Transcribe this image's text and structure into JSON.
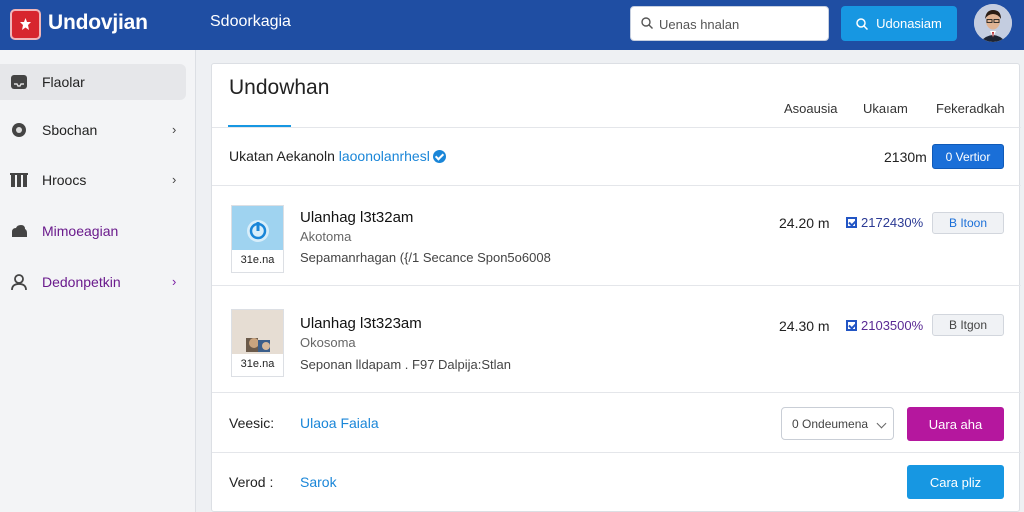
{
  "header": {
    "brand": "Undovjian",
    "nav_tab": "Sdoorkagia",
    "search_placeholder": "Uenas hnalan",
    "search_button": "Udonasiam"
  },
  "sidebar": {
    "items": [
      {
        "label": "Flaolar",
        "icon": "inbox-icon"
      },
      {
        "label": "Sbochan",
        "icon": "disc-icon"
      },
      {
        "label": "Hroocs",
        "icon": "library-icon"
      },
      {
        "label": "Mimoeagian",
        "icon": "cloud-upload-icon"
      },
      {
        "label": "Dedonpetkin",
        "icon": "user-icon"
      }
    ]
  },
  "main": {
    "title": "Undowhan",
    "tabs": [
      "Asoausia",
      "Ukaıam",
      "Fekeradkah"
    ],
    "info": {
      "prefix": "Ukatan Aekanoln",
      "link": "laoonolanrhesl",
      "time": "2130m",
      "button": "0 Vertior"
    },
    "items": [
      {
        "thumb_caption": "31e.na",
        "title": "Ulanhag l3t32am",
        "subtitle": "Akotoma",
        "meta": "Sepamanrhagan ({/1 Secance Spon5o6008",
        "time": "24.20 m",
        "stat": "2172430%",
        "tag": "B Itoon"
      },
      {
        "thumb_caption": "31e.na",
        "title": "Ulanhag l3t323am",
        "subtitle": "Okosoma",
        "meta": "Seponan lldapam . F97 Dalpija:Stlan",
        "time": "24.30 m",
        "stat": "2103500%",
        "tag": "B Itgon"
      }
    ],
    "form": {
      "row1_label": "Veesic:",
      "row1_value": "Ulaoa Faiala",
      "select_value": "0 Ondeumena",
      "primary_button": "Uara aha",
      "row2_label": "Verod :",
      "row2_value": "Sarok",
      "secondary_button": "Cara pliz"
    }
  },
  "colors": {
    "header_bg": "#1f4ea3",
    "accent_blue": "#1797e2",
    "primary_magenta": "#b5179e"
  }
}
